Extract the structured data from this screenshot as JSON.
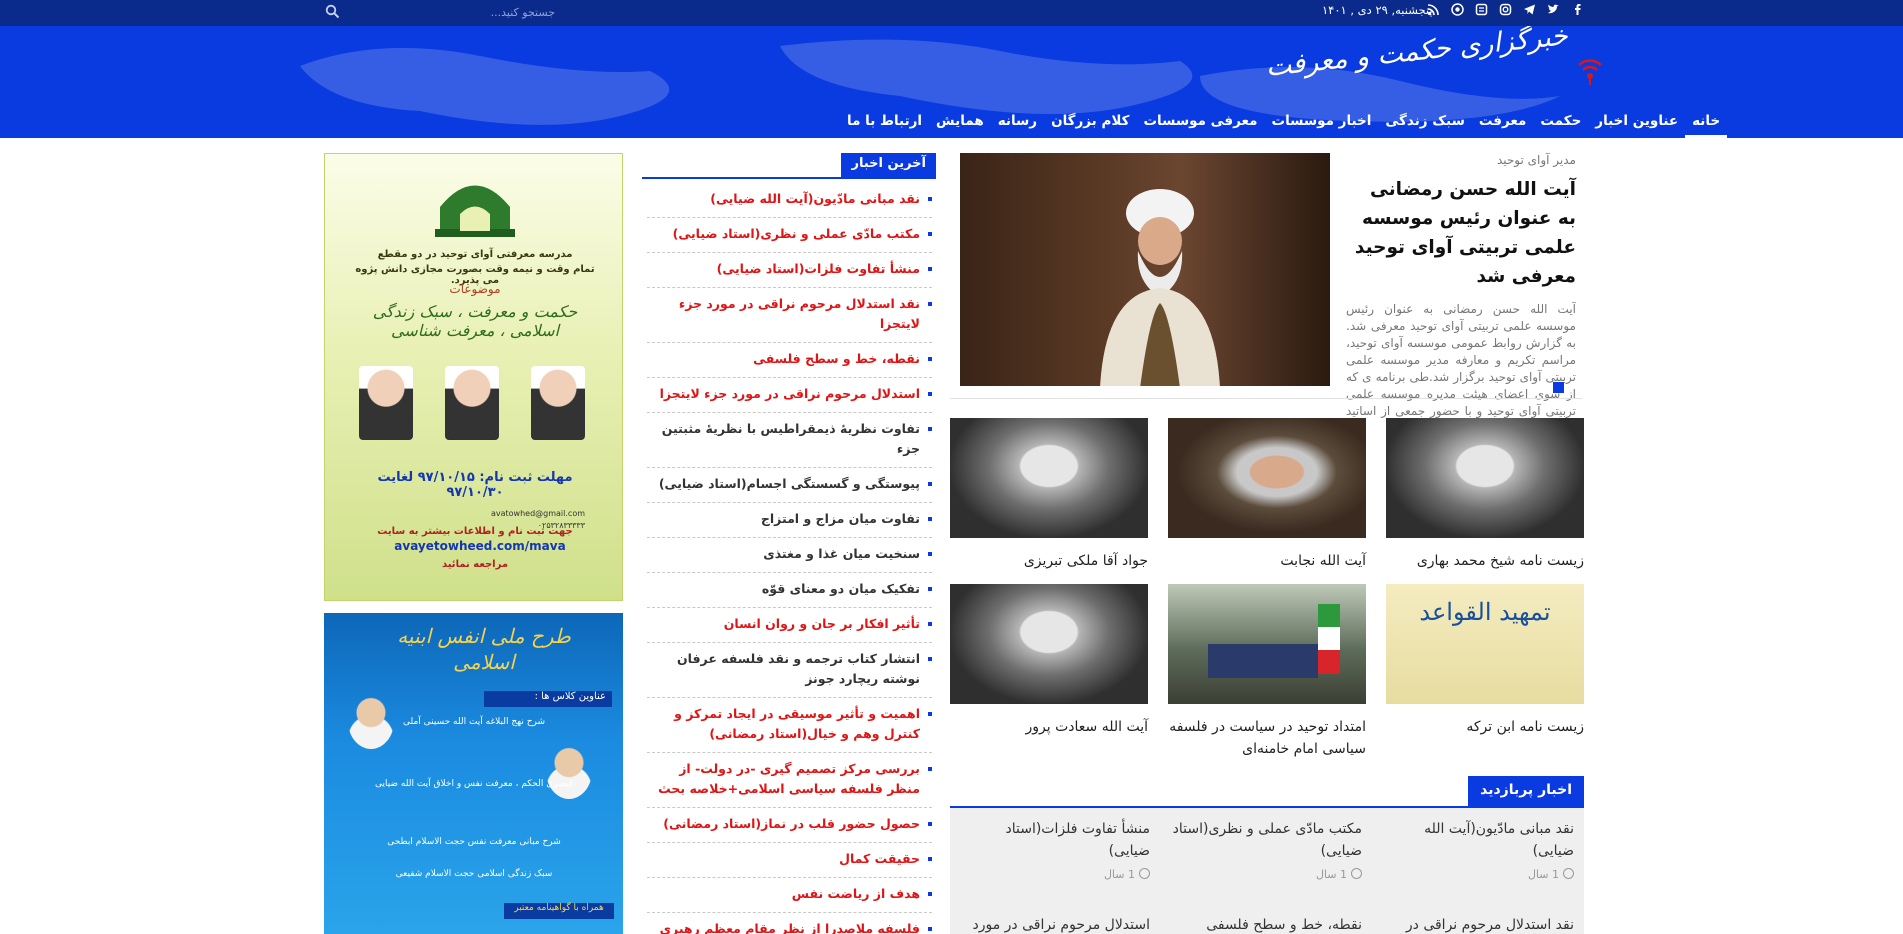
{
  "topbar": {
    "date": "پنجشنبه, ۲۹ دی , ۱۴۰۱",
    "search_placeholder": "جستجو کنید...",
    "social_icons": [
      "rss-icon",
      "app-icon-1",
      "app-icon-2",
      "instagram-icon",
      "telegram-icon",
      "twitter-icon",
      "facebook-icon"
    ]
  },
  "header": {
    "logo_text": "خبرگزاری حکمت و معرفت",
    "nav": [
      "خانه",
      "عناوین اخبار",
      "حکمت",
      "معرفت",
      "سبک زندگی",
      "اخبار موسسات",
      "معرفی موسسات",
      "کلام بزرگان",
      "رسانه",
      "همایش",
      "ارتباط با ما"
    ]
  },
  "banner1": {
    "line1": "مدرسه معرفتی آوای توحید در دو مقطع",
    "line2": "تمام وقت و نیمه وقت بصورت مجازی دانش پژوه می پذیرد.",
    "subjects_label": "موضوعات",
    "subjects": "حکمت و معرفت ، سبک زندگی اسلامی ، معرفت شناسی",
    "deadline": "مهلت ثبت نام: ۹۷/۱۰/۱۵ لغایت ۹۷/۱۰/۳۰",
    "email": "avatowhed@gmail.com",
    "phone": "۰۲۵۳۲۸۳۳۳۳۳",
    "cta": "جهت ثبت نام و اطلاعات بیشتر به سایت",
    "url": "avayetowheed.com/mava",
    "footer": "مراجعه نمائید"
  },
  "banner2": {
    "title": "طرح ملی انفس ابنیه اسلامی",
    "classes_label": "عناوین کلاس ها :",
    "lines": [
      "شرح نهج البلاغه آیت الله حسینی آملی",
      "قیصری الحکم ، معرفت نفس و اخلاق آیت الله ضیایی",
      "شرح مبانی معرفت نفس حجت الاسلام ابطحی",
      "سبک زندگی اسلامی حجت الاسلام شفیعی"
    ],
    "bottom": "همراه با گواهینامه معتبر"
  },
  "latest": {
    "heading": "آخرین اخبار",
    "items": [
      {
        "text": "نقد مبانی مادّیون(آیت الله ضیایی)",
        "red": true
      },
      {
        "text": "مکتب مادّی عملی و نظری(استاد ضیایی)",
        "red": true
      },
      {
        "text": "منشأ تفاوت فلزات(استاد ضیایی)",
        "red": true
      },
      {
        "text": "نقد استدلال مرحوم نراقی در مورد جزء لایتجزا",
        "red": true
      },
      {
        "text": "نقطه، خط و سطح فلسفی",
        "red": true
      },
      {
        "text": "استدلال مرحوم نراقی در مورد جزء لایتجزا",
        "red": true
      },
      {
        "text": "تفاوت نظریۀ ذیمقراطیس با نظریۀ مثبتین جزء",
        "red": false
      },
      {
        "text": "پیوستگی و گسستگی اجسام(استاد ضیایی)",
        "red": false
      },
      {
        "text": "تفاوت میان مزاج و امتزاج",
        "red": false
      },
      {
        "text": "سنخیت میان غذا و مغتذی",
        "red": false
      },
      {
        "text": "تفکیک میان دو معنای قوّه",
        "red": false
      },
      {
        "text": "تأثیر افکار بر جان و روان انسان",
        "red": true
      },
      {
        "text": "انتشار کتاب ترجمه و نقد فلسفه عرفان نوشته ریچارد جونز",
        "red": false
      },
      {
        "text": "اهمیت و تأثیر موسیقی در ایجاد تمرکز و کنترل وهم و خیال(استاد رمضانی)",
        "red": true
      },
      {
        "text": "بررسی مرکز تصمیم گیری -در دولت- از منظر فلسفه سیاسی اسلامی+خلاصه بحث",
        "red": true
      },
      {
        "text": "حصول حضور قلب در نماز(استاد رمضانی)",
        "red": true
      },
      {
        "text": "حقیقت کمال",
        "red": true
      },
      {
        "text": "هدف از ریاضت نفس",
        "red": true
      },
      {
        "text": "فلسفه ملاصدرا از نظر مقام معظم رهبری",
        "red": true
      }
    ]
  },
  "featured": {
    "author": "مدیر آوای توحید",
    "title": "آیت الله حسن رمضانی به عنوان رئیس موسسه علمی تربیتی آوای توحید معرفی شد",
    "excerpt": "آیت الله حسن رمضانی به عنوان رئیس موسسه علمی تربیتی آوای توحید معرفی شد. به گزارش روابط عمومی موسسه آوای توحید، مراسم تکریم و معارفه مدیر موسسه علمی تربیتی آوای توحید برگزار شد.طی برنامه ی که از سوی اعضای هیئت مدیره موسسه علمی تربیتی آوای توحید و با حضور جمعی از اساتید و علما برگزار شد، با تقدیر از زحمات"
  },
  "cards": [
    {
      "caption": "زیست نامه شیخ محمد بهاری",
      "thumb": "bw"
    },
    {
      "caption": "آیت الله نجابت",
      "thumb": "color1"
    },
    {
      "caption": "جواد آقا ملکی تبریزی",
      "thumb": "bw"
    },
    {
      "caption": "زیست نامه ابن ترکه",
      "thumb": "book"
    },
    {
      "caption": "امتداد توحید در سیاست در فلسفه سیاسی امام خامنه‌ای",
      "thumb": "conf"
    },
    {
      "caption": "آیت الله سعادت پرور",
      "thumb": "bw"
    }
  ],
  "popular": {
    "heading": "اخبار پربازدید",
    "items": [
      {
        "title": "نقد مبانی مادّیون(آیت الله ضیایی)",
        "meta": "1 سال"
      },
      {
        "title": "مکتب مادّی عملی و نظری(استاد ضیایی)",
        "meta": "1 سال"
      },
      {
        "title": "منشأ تفاوت فلزات(استاد ضیایی)",
        "meta": "1 سال"
      },
      {
        "title": "نقد استدلال مرحوم نراقی در مورد",
        "meta": ""
      },
      {
        "title": "نقطه، خط و سطح فلسفی",
        "meta": ""
      },
      {
        "title": "استدلال مرحوم نراقی در مورد",
        "meta": ""
      }
    ]
  },
  "colors": {
    "topbar": "#0a2a8c",
    "header": "#0a3be0",
    "accent_red": "#e01414"
  }
}
